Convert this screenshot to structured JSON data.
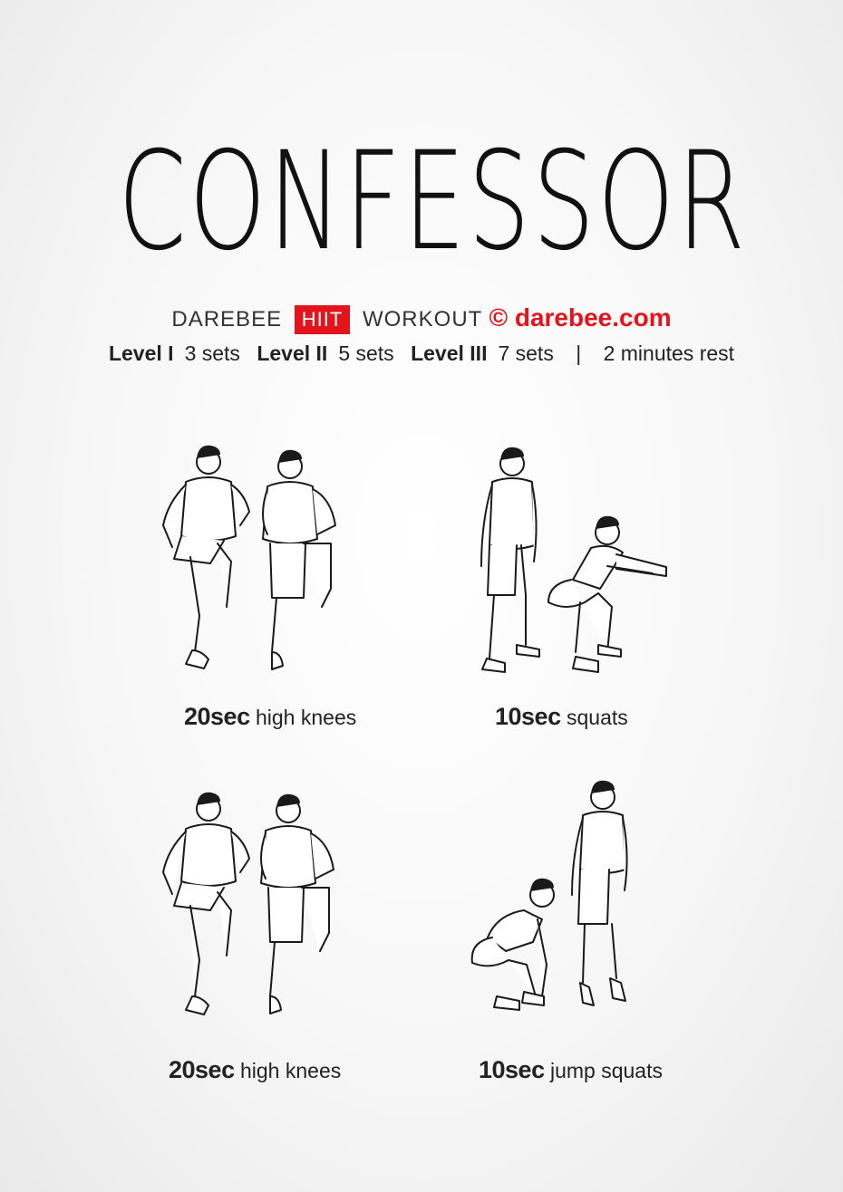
{
  "title": "CONFESSOR",
  "subtitle": {
    "brand": "DAREBEE",
    "badge": "HIIT",
    "type": "WORKOUT",
    "copyright": "©",
    "site": "darebee.com"
  },
  "levels": [
    {
      "label": "Level I",
      "value": "3 sets"
    },
    {
      "label": "Level II",
      "value": "5 sets"
    },
    {
      "label": "Level III",
      "value": "7 sets"
    }
  ],
  "rest": "2 minutes rest",
  "exercises": [
    {
      "duration": "20sec",
      "name": "high knees"
    },
    {
      "duration": "10sec",
      "name": "squats"
    },
    {
      "duration": "20sec",
      "name": "high knees"
    },
    {
      "duration": "10sec",
      "name": "jump squats"
    }
  ],
  "colors": {
    "accent": "#e3141b",
    "text": "#222222"
  }
}
